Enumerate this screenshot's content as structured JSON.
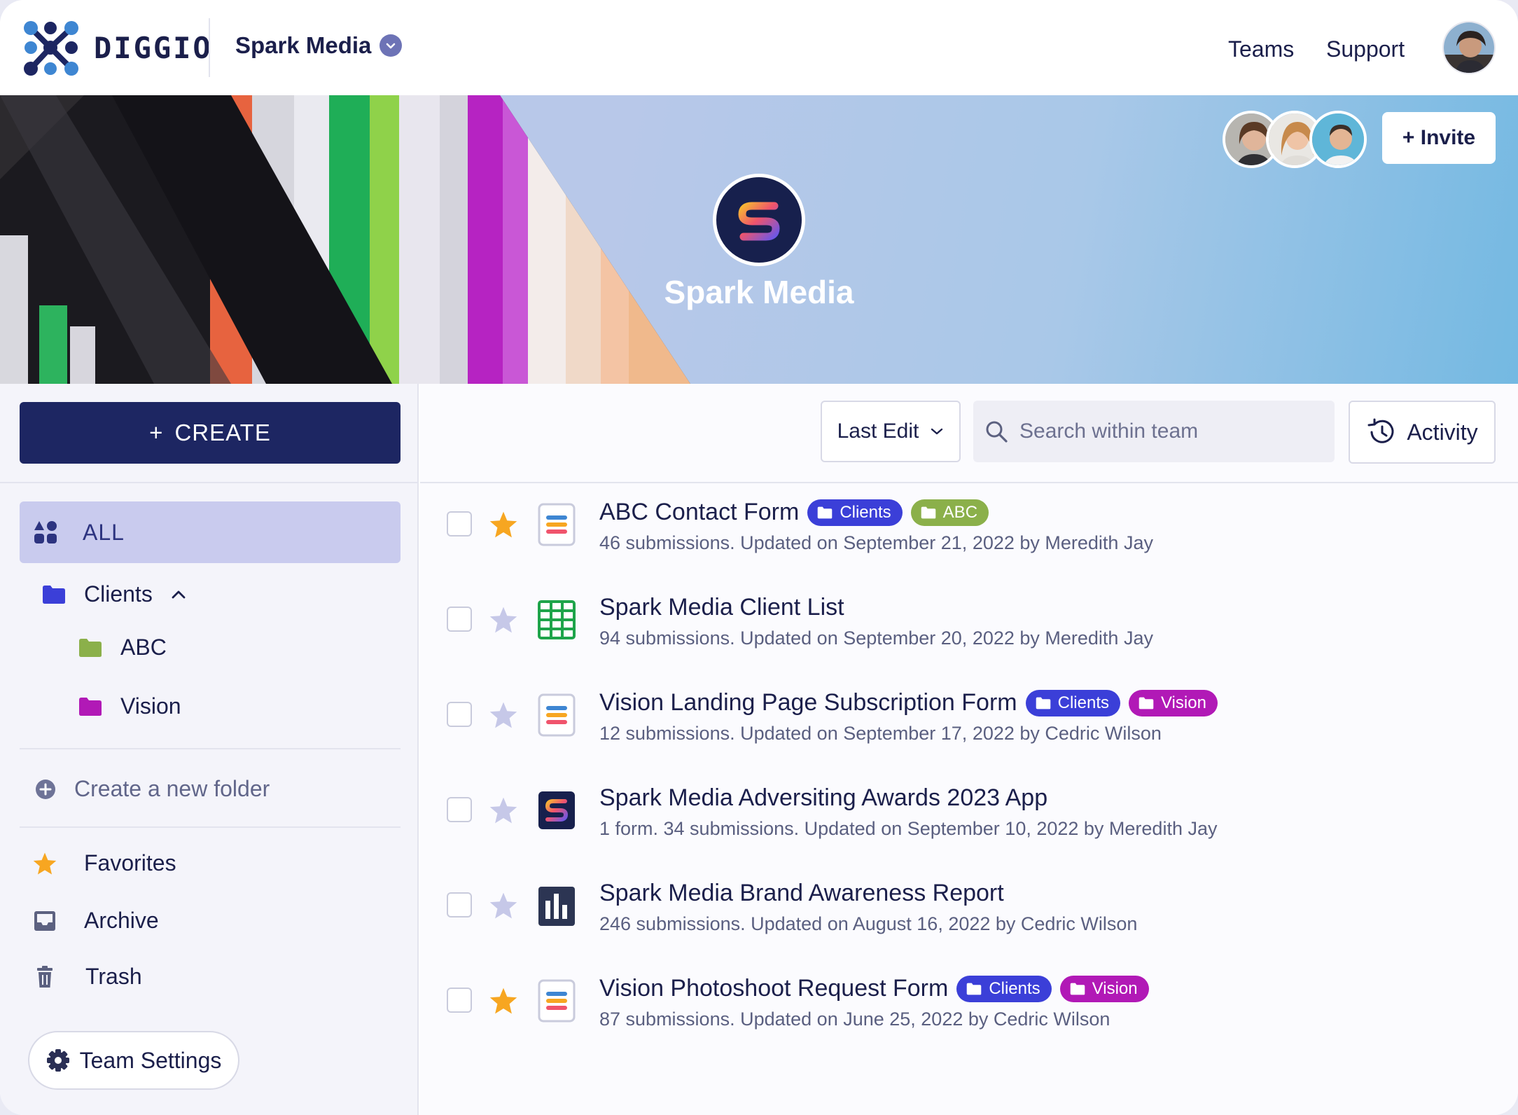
{
  "brand": {
    "name": "DIGGIO"
  },
  "header": {
    "team_name": "Spark Media",
    "nav": [
      "Teams",
      "Support"
    ]
  },
  "banner": {
    "team_title": "Spark Media",
    "invite_label": "+ Invite"
  },
  "sidebar": {
    "create_label": "CREATE",
    "all_label": "ALL",
    "folders": [
      {
        "label": "Clients",
        "color": "#3b3fd8"
      },
      {
        "label": "ABC",
        "color": "#8bb04a"
      },
      {
        "label": "Vision",
        "color": "#b119b6"
      }
    ],
    "new_folder_label": "Create a new folder",
    "links": [
      "Favorites",
      "Archive",
      "Trash"
    ],
    "team_settings_label": "Team Settings"
  },
  "toolbar": {
    "sort_label": "Last Edit",
    "search_placeholder": "Search within team",
    "activity_label": "Activity"
  },
  "items": [
    {
      "title": "ABC Contact Form",
      "subtitle": "46 submissions. Updated on September 21, 2022 by Meredith Jay",
      "starred": true,
      "icon": "form-icon",
      "tags": [
        {
          "label": "Clients",
          "color": "#3b3fd8"
        },
        {
          "label": "ABC",
          "color": "#8bb04a"
        }
      ]
    },
    {
      "title": "Spark Media Client List",
      "subtitle": "94 submissions. Updated on September 20, 2022 by Meredith Jay",
      "starred": false,
      "icon": "table-icon",
      "tags": []
    },
    {
      "title": "Vision Landing Page Subscription Form",
      "subtitle": "12 submissions. Updated on September 17, 2022 by Cedric Wilson",
      "starred": false,
      "icon": "form-icon",
      "tags": [
        {
          "label": "Clients",
          "color": "#3b3fd8"
        },
        {
          "label": "Vision",
          "color": "#b119b6"
        }
      ]
    },
    {
      "title": "Spark Media Adversiting Awards 2023 App",
      "subtitle": "1 form. 34 submissions. Updated on September 10, 2022 by Meredith Jay",
      "starred": false,
      "icon": "app-icon",
      "tags": []
    },
    {
      "title": "Spark Media Brand Awareness Report",
      "subtitle": "246 submissions. Updated on August 16, 2022 by Cedric Wilson",
      "starred": false,
      "icon": "report-icon",
      "tags": []
    },
    {
      "title": "Vision Photoshoot Request Form",
      "subtitle": "87 submissions. Updated on June 25, 2022 by Cedric Wilson",
      "starred": true,
      "icon": "form-icon",
      "tags": [
        {
          "label": "Clients",
          "color": "#3b3fd8"
        },
        {
          "label": "Vision",
          "color": "#b119b6"
        }
      ]
    }
  ]
}
